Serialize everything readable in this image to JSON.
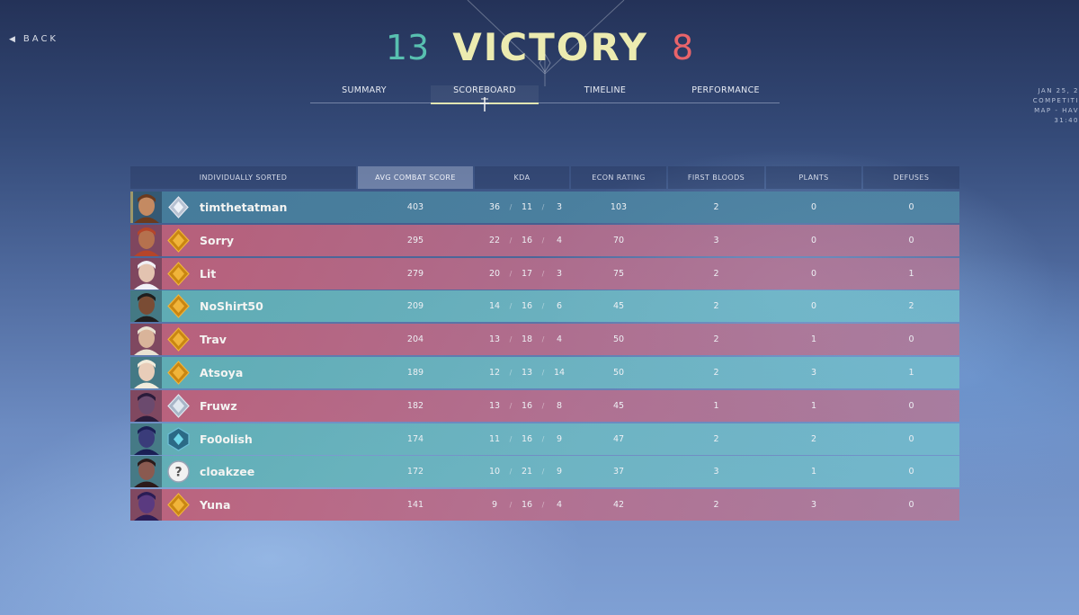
{
  "nav": {
    "back_label": "BACK"
  },
  "result": {
    "team_score": "13",
    "title": "VICTORY",
    "enemy_score": "8"
  },
  "tabs": [
    {
      "label": "SUMMARY",
      "active": false
    },
    {
      "label": "SCOREBOARD",
      "active": true
    },
    {
      "label": "TIMELINE",
      "active": false
    },
    {
      "label": "PERFORMANCE",
      "active": false
    }
  ],
  "match_info": {
    "date": "JAN 25, 2",
    "mode": "COMPETITI",
    "map": "MAP - HAV",
    "duration": "31:40"
  },
  "columns": {
    "player": "INDIVIDUALLY SORTED",
    "acs": "AVG COMBAT SCORE",
    "kda": "KDA",
    "econ": "ECON RATING",
    "first_bloods": "FIRST BLOODS",
    "plants": "PLANTS",
    "defuses": "DEFUSES"
  },
  "players": [
    {
      "name": "timthetatman",
      "team": "self",
      "rank_icon": "diamond-rank-icon",
      "acs": "403",
      "k": "36",
      "d": "11",
      "a": "3",
      "econ": "103",
      "fb": "2",
      "plants": "0",
      "defuses": "0"
    },
    {
      "name": "Sorry",
      "team": "enemy",
      "rank_icon": "gold-rank-icon",
      "acs": "295",
      "k": "22",
      "d": "16",
      "a": "4",
      "econ": "70",
      "fb": "3",
      "plants": "0",
      "defuses": "0"
    },
    {
      "name": "Lit",
      "team": "enemy",
      "rank_icon": "gold-rank-icon",
      "acs": "279",
      "k": "20",
      "d": "17",
      "a": "3",
      "econ": "75",
      "fb": "2",
      "plants": "0",
      "defuses": "1"
    },
    {
      "name": "NoShirt50",
      "team": "ally",
      "rank_icon": "gold-rank-icon",
      "acs": "209",
      "k": "14",
      "d": "16",
      "a": "6",
      "econ": "45",
      "fb": "2",
      "plants": "0",
      "defuses": "2"
    },
    {
      "name": "Trav",
      "team": "enemy",
      "rank_icon": "gold-rank-icon",
      "acs": "204",
      "k": "13",
      "d": "18",
      "a": "4",
      "econ": "50",
      "fb": "2",
      "plants": "1",
      "defuses": "0"
    },
    {
      "name": "Atsoya",
      "team": "ally",
      "rank_icon": "gold-rank-icon",
      "acs": "189",
      "k": "12",
      "d": "13",
      "a": "14",
      "econ": "50",
      "fb": "2",
      "plants": "3",
      "defuses": "1"
    },
    {
      "name": "Fruwz",
      "team": "enemy",
      "rank_icon": "platinum-rank-icon",
      "acs": "182",
      "k": "13",
      "d": "16",
      "a": "8",
      "econ": "45",
      "fb": "1",
      "plants": "1",
      "defuses": "0"
    },
    {
      "name": "Fo0olish",
      "team": "ally",
      "rank_icon": "diamond-rank-icon",
      "acs": "174",
      "k": "11",
      "d": "16",
      "a": "9",
      "econ": "47",
      "fb": "2",
      "plants": "2",
      "defuses": "0"
    },
    {
      "name": "cloakzee",
      "team": "ally",
      "rank_icon": "unranked-icon",
      "acs": "172",
      "k": "10",
      "d": "21",
      "a": "9",
      "econ": "37",
      "fb": "3",
      "plants": "1",
      "defuses": "0"
    },
    {
      "name": "Yuna",
      "team": "enemy",
      "rank_icon": "gold-rank-icon",
      "acs": "141",
      "k": "9",
      "d": "16",
      "a": "4",
      "econ": "42",
      "fb": "2",
      "plants": "3",
      "defuses": "0"
    }
  ],
  "colors": {
    "team_score": "#58c0b0",
    "enemy_score": "#e9646a",
    "result_title": "#ecebb0",
    "ally_row": "#5fafb4",
    "enemy_row": "#be5f78",
    "self_row": "#467d9b"
  }
}
